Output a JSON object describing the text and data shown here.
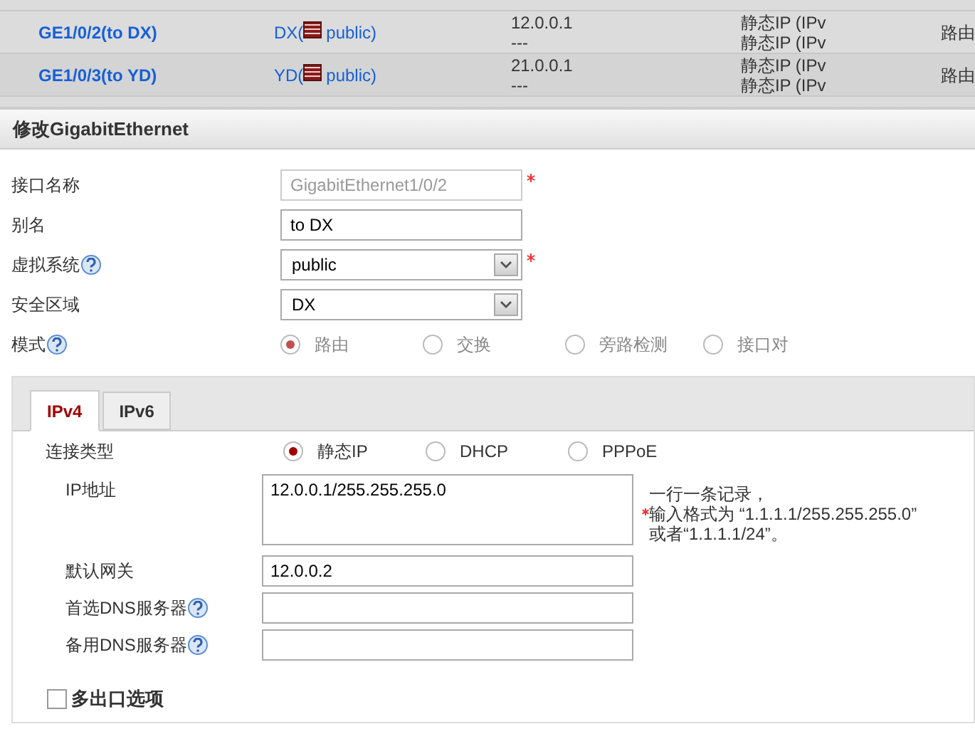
{
  "table": {
    "rows": [
      {
        "name": "GE1/0/2(to DX)",
        "zone": "DX(",
        "vsys": "public)",
        "addresses": [
          "12.0.0.1",
          "---"
        ],
        "types": [
          "静态IP (IPv",
          "静态IP (IPv"
        ],
        "mode": "路由"
      },
      {
        "name": "GE1/0/3(to YD)",
        "zone": "YD(",
        "vsys": "public)",
        "addresses": [
          "21.0.0.1",
          "---"
        ],
        "types": [
          "静态IP (IPv",
          "静态IP (IPv"
        ],
        "mode": "路由"
      }
    ]
  },
  "dialog": {
    "title": "修改GigabitEthernet",
    "fields": [
      {
        "kind": "text",
        "label": "接口名称",
        "value": "GigabitEthernet1/0/2",
        "disabled": true,
        "required": true,
        "help": false
      },
      {
        "kind": "text",
        "label": "别名",
        "value": "to DX",
        "disabled": false,
        "required": false,
        "help": false
      },
      {
        "kind": "select",
        "label": "虚拟系统",
        "value": "public",
        "required": true,
        "help": true
      },
      {
        "kind": "select",
        "label": "安全区域",
        "value": "DX",
        "required": false,
        "help": false
      },
      {
        "kind": "radio",
        "label": "模式",
        "help": true,
        "disabled": true,
        "options": [
          {
            "label": "路由",
            "selected": true
          },
          {
            "label": "交换",
            "selected": false
          },
          {
            "label": "旁路检测",
            "selected": false
          },
          {
            "label": "接口对",
            "selected": false
          }
        ]
      }
    ],
    "tabs": [
      {
        "label": "IPv4",
        "selected": true
      },
      {
        "label": "IPv6",
        "selected": false
      }
    ],
    "connection": {
      "label": "连接类型",
      "options": [
        {
          "label": "静态IP",
          "selected": true
        },
        {
          "label": "DHCP",
          "selected": false
        },
        {
          "label": "PPPoE",
          "selected": false
        }
      ]
    },
    "ip": {
      "label": "IP地址",
      "value": "12.0.0.1/255.255.255.0",
      "hint": [
        "一行一条记录，",
        "输入格式为 “1.1.1.1/255.255.255.0”",
        "或者“1.1.1.1/24”。"
      ]
    },
    "gateway": {
      "label": "默认网关",
      "value": "12.0.0.2"
    },
    "dns": [
      {
        "label": "首选DNS服务器"
      },
      {
        "label": "备用DNS服务器"
      }
    ],
    "multi_exit": {
      "label": "多出口选项",
      "checked": false
    }
  }
}
